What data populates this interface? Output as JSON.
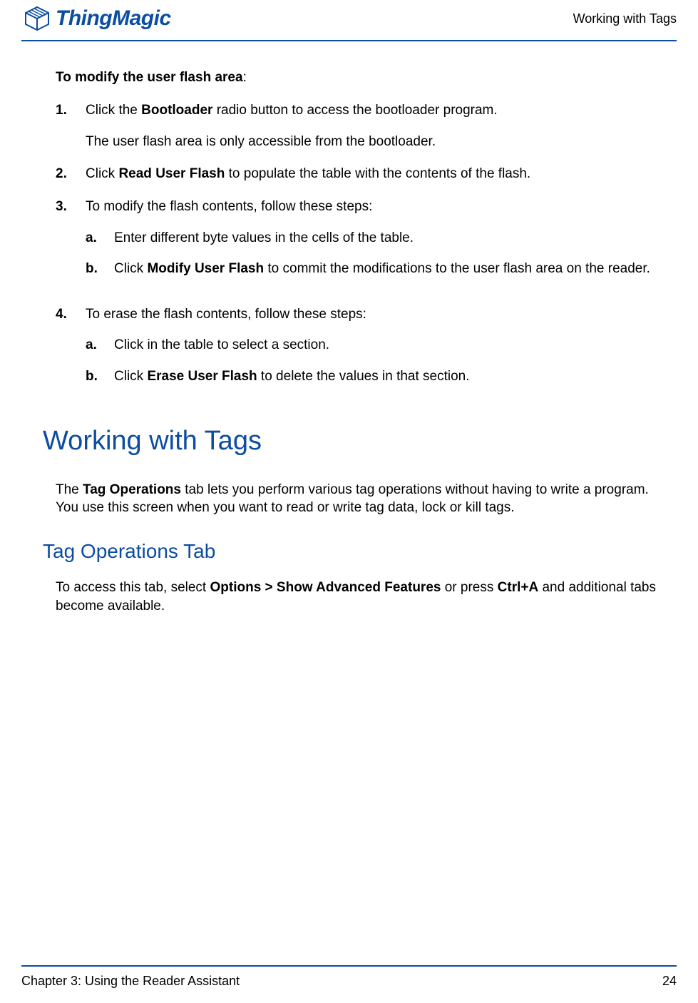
{
  "header": {
    "brand": "ThingMagic",
    "section_title": "Working with Tags"
  },
  "intro": {
    "prefix": "To modify the user flash area",
    "colon": ":"
  },
  "steps": [
    {
      "num": "1.",
      "text_before": "Click the ",
      "bold": "Bootloader",
      "text_after": " radio button to access the bootloader program.",
      "note": "The user flash area is only accessible from the bootloader."
    },
    {
      "num": "2.",
      "text_before": "Click ",
      "bold": "Read User Flash",
      "text_after": " to populate the table with the contents of the flash."
    },
    {
      "num": "3.",
      "text_plain": "To modify the flash contents, follow these steps:",
      "sub": [
        {
          "marker": "a.",
          "text_plain": "Enter different byte values in the cells of the table."
        },
        {
          "marker": "b.",
          "text_before": "Click ",
          "bold": "Modify User Flash",
          "text_after": " to commit the modifications to the user flash area on the reader."
        }
      ]
    },
    {
      "num": "4.",
      "text_plain": "To erase the flash contents, follow these steps:",
      "sub": [
        {
          "marker": "a.",
          "text_plain": "Click in the table to select a section."
        },
        {
          "marker": "b.",
          "text_before": "Click ",
          "bold": "Erase User Flash",
          "text_after": " to delete the values in that section."
        }
      ]
    }
  ],
  "h1": "Working with Tags",
  "para1": {
    "before": "The ",
    "bold": "Tag Operations",
    "after": " tab lets you perform various tag operations without having to write a program. You use this screen when you want to read or write tag data, lock or kill tags."
  },
  "h2": "Tag Operations Tab",
  "para2": {
    "before": "To access this tab, select ",
    "bold1": "Options > Show Advanced Features",
    "mid": " or press ",
    "bold2": "Ctrl+A",
    "after": " and additional tabs become available."
  },
  "footer": {
    "chapter": "Chapter 3: Using the Reader Assistant",
    "page": "24"
  }
}
